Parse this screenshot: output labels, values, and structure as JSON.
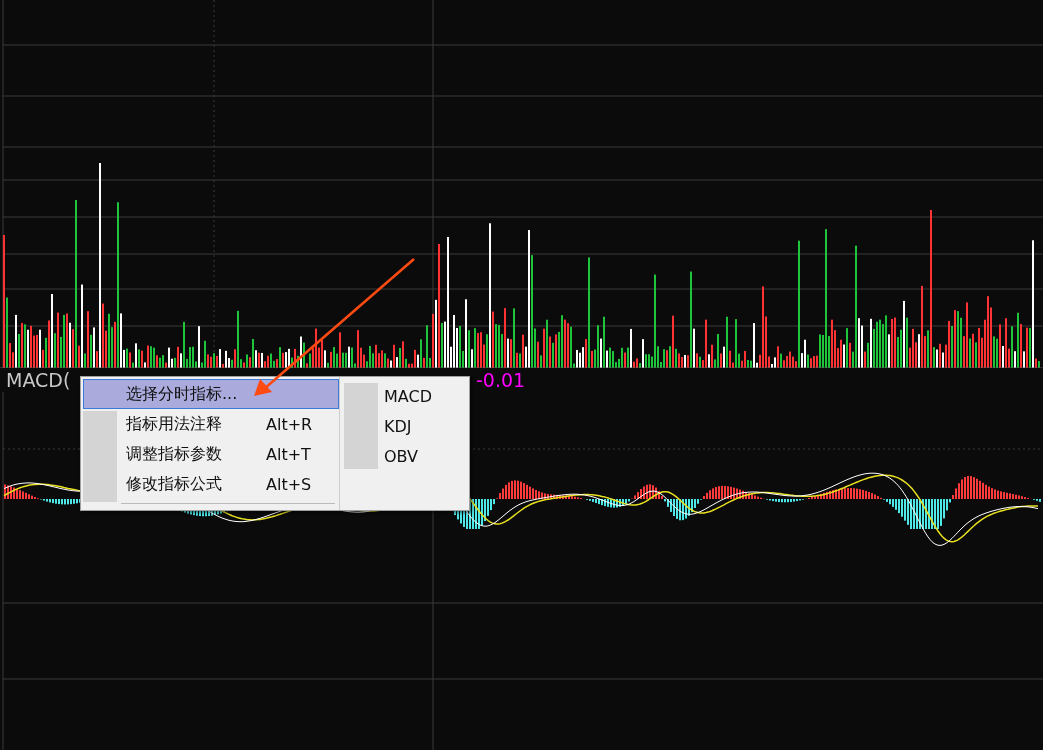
{
  "indicator_label": {
    "name": "MACD(",
    "value": "-0.01"
  },
  "context_menu": {
    "items": [
      {
        "label": "选择分时指标...",
        "selected": true
      },
      {
        "label": "指标用法注释",
        "shortcut": "Alt+R",
        "selected": false
      },
      {
        "label": "调整指标参数",
        "shortcut": "Alt+T",
        "selected": false
      },
      {
        "label": "修改指标公式",
        "shortcut": "Alt+S",
        "selected": false
      }
    ],
    "submenu": [
      {
        "label": "MACD"
      },
      {
        "label": "KDJ"
      },
      {
        "label": "OBV"
      }
    ]
  }
}
